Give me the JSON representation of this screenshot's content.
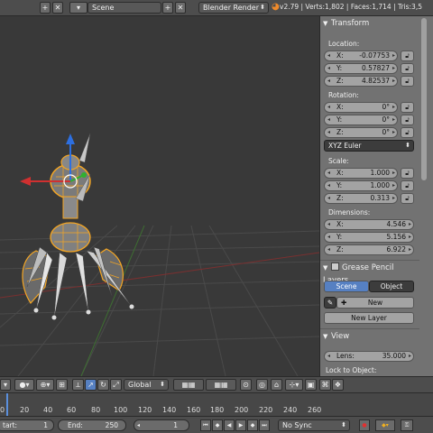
{
  "header": {
    "close_a": "✕",
    "add_a": "+",
    "scene_field": "Scene",
    "add_b": "+",
    "close_b": "✕",
    "render_engine": "Blender Render",
    "stats": "v2.79 | Verts:1,802 | Faces:1,714 | Tris:3,5"
  },
  "panel": {
    "transform_title": "Transform",
    "location_label": "Location:",
    "location": [
      {
        "axis": "X:",
        "value": "-0.07753"
      },
      {
        "axis": "Y:",
        "value": "0.57827"
      },
      {
        "axis": "Z:",
        "value": "4.82537"
      }
    ],
    "rotation_label": "Rotation:",
    "rotation": [
      {
        "axis": "X:",
        "value": "0°"
      },
      {
        "axis": "Y:",
        "value": "0°"
      },
      {
        "axis": "Z:",
        "value": "0°"
      }
    ],
    "rotation_mode": "XYZ Euler",
    "scale_label": "Scale:",
    "scale": [
      {
        "axis": "X:",
        "value": "1.000"
      },
      {
        "axis": "Y:",
        "value": "1.000"
      },
      {
        "axis": "Z:",
        "value": "0.313"
      }
    ],
    "dimensions_label": "Dimensions:",
    "dimensions": [
      {
        "axis": "X:",
        "value": "4.546"
      },
      {
        "axis": "Y:",
        "value": "5.156"
      },
      {
        "axis": "Z:",
        "value": "6.922"
      }
    ],
    "grease_title": "Grease Pencil Layers",
    "tab_scene": "Scene",
    "tab_object": "Object",
    "new_button": "New",
    "new_layer_button": "New Layer",
    "view_title": "View",
    "lens_label": "Lens:",
    "lens_value": "35.000",
    "lock_to_object": "Lock to Object:"
  },
  "viewport_header": {
    "orientation": "Global"
  },
  "timeline": {
    "ticks": [
      "0",
      "20",
      "40",
      "60",
      "80",
      "100",
      "120",
      "140",
      "160",
      "180",
      "200",
      "220",
      "240",
      "260"
    ]
  },
  "timeline_bar": {
    "start_label": "tart:",
    "start_value": "1",
    "end_label": "End:",
    "end_value": "250",
    "current_frame": "1",
    "sync_mode": "No Sync"
  }
}
